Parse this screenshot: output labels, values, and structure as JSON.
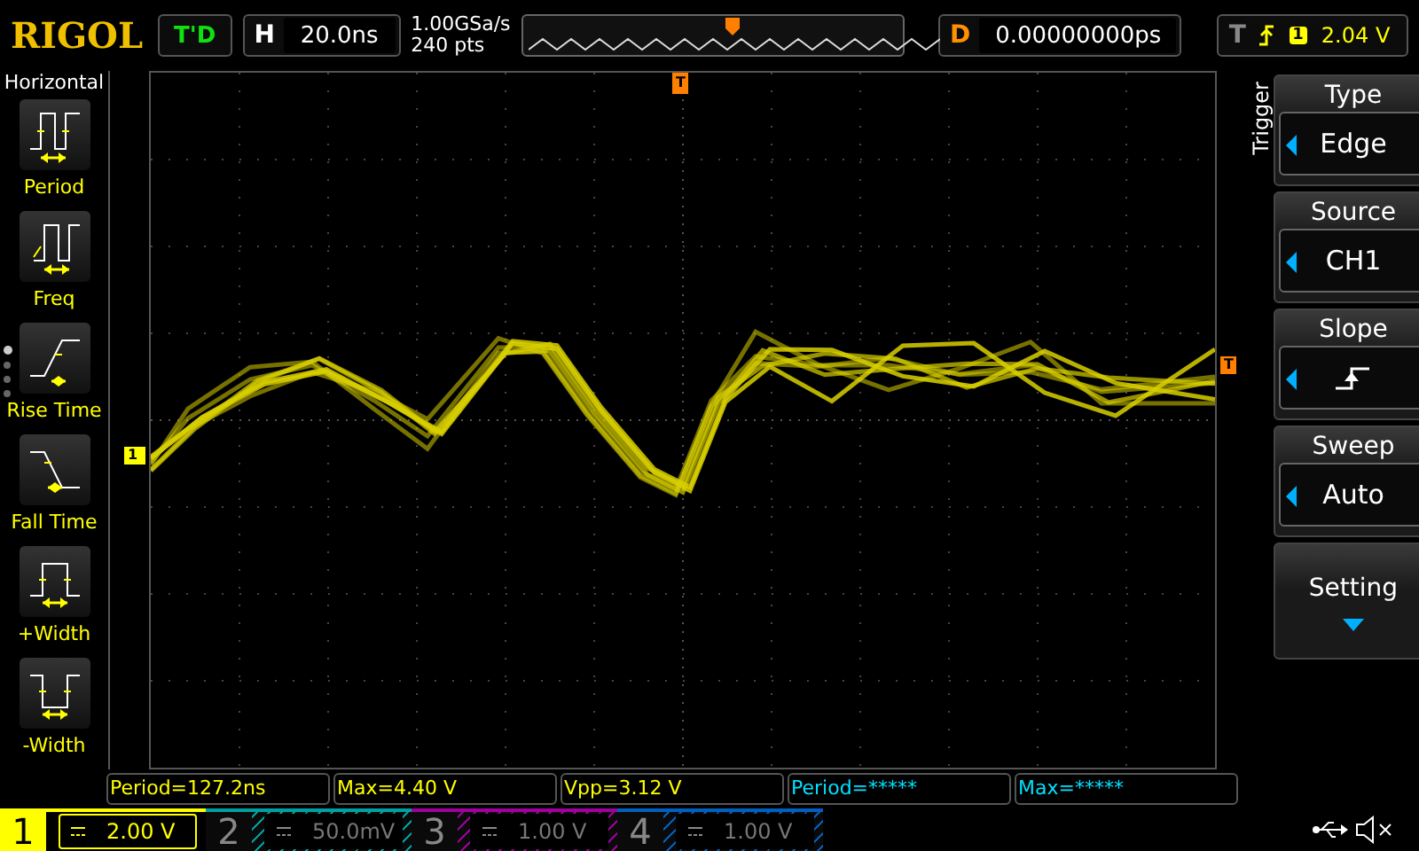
{
  "brand": "RIGOL",
  "run_status": "T'D",
  "timebase": {
    "label": "H",
    "value": "20.0ns"
  },
  "sample": {
    "rate": "1.00GSa/s",
    "depth": "240 pts"
  },
  "delay": {
    "label": "D",
    "value": "0.00000000ps"
  },
  "trigger": {
    "label": "T",
    "channel": "1",
    "level": "2.04 V"
  },
  "measure_menu": {
    "title": "Horizontal",
    "items": [
      {
        "label": "Period",
        "kind": "period"
      },
      {
        "label": "Freq",
        "kind": "freq"
      },
      {
        "label": "Rise Time",
        "kind": "rise"
      },
      {
        "label": "Fall Time",
        "kind": "fall"
      },
      {
        "label": "+Width",
        "kind": "pwidth"
      },
      {
        "label": "-Width",
        "kind": "nwidth"
      }
    ],
    "pages": [
      {
        "selected": true
      },
      {
        "selected": false
      },
      {
        "selected": false
      },
      {
        "selected": false
      }
    ]
  },
  "markers": {
    "channel": "1",
    "trigger_level": "T",
    "trigger_position": "T"
  },
  "trigger_menu": {
    "title": "Trigger",
    "items": [
      {
        "kind": "select",
        "label": "Type",
        "value": "Edge"
      },
      {
        "kind": "select",
        "label": "Source",
        "value": "CH1"
      },
      {
        "kind": "slope",
        "label": "Slope"
      },
      {
        "kind": "select",
        "label": "Sweep",
        "value": "Auto"
      },
      {
        "kind": "submenu",
        "label": "Setting"
      }
    ]
  },
  "measurements": [
    {
      "text": "Period=127.2ns",
      "color": "#ffff00"
    },
    {
      "text": "Max=4.40 V",
      "color": "#ffff00"
    },
    {
      "text": "Vpp=3.12 V",
      "color": "#ffff00"
    },
    {
      "text": "Period=*****",
      "color": "#00e0ff"
    },
    {
      "text": "Max=*****",
      "color": "#00e0ff"
    }
  ],
  "channels": [
    {
      "number": "1",
      "scale": "2.00 V",
      "active": true,
      "color": "#ffff00"
    },
    {
      "number": "2",
      "scale": "50.0mV",
      "active": false,
      "color": "#00a0a0"
    },
    {
      "number": "3",
      "scale": "1.00 V",
      "active": false,
      "color": "#a000a0"
    },
    {
      "number": "4",
      "scale": "1.00 V",
      "active": false,
      "color": "#0060c0"
    }
  ]
}
